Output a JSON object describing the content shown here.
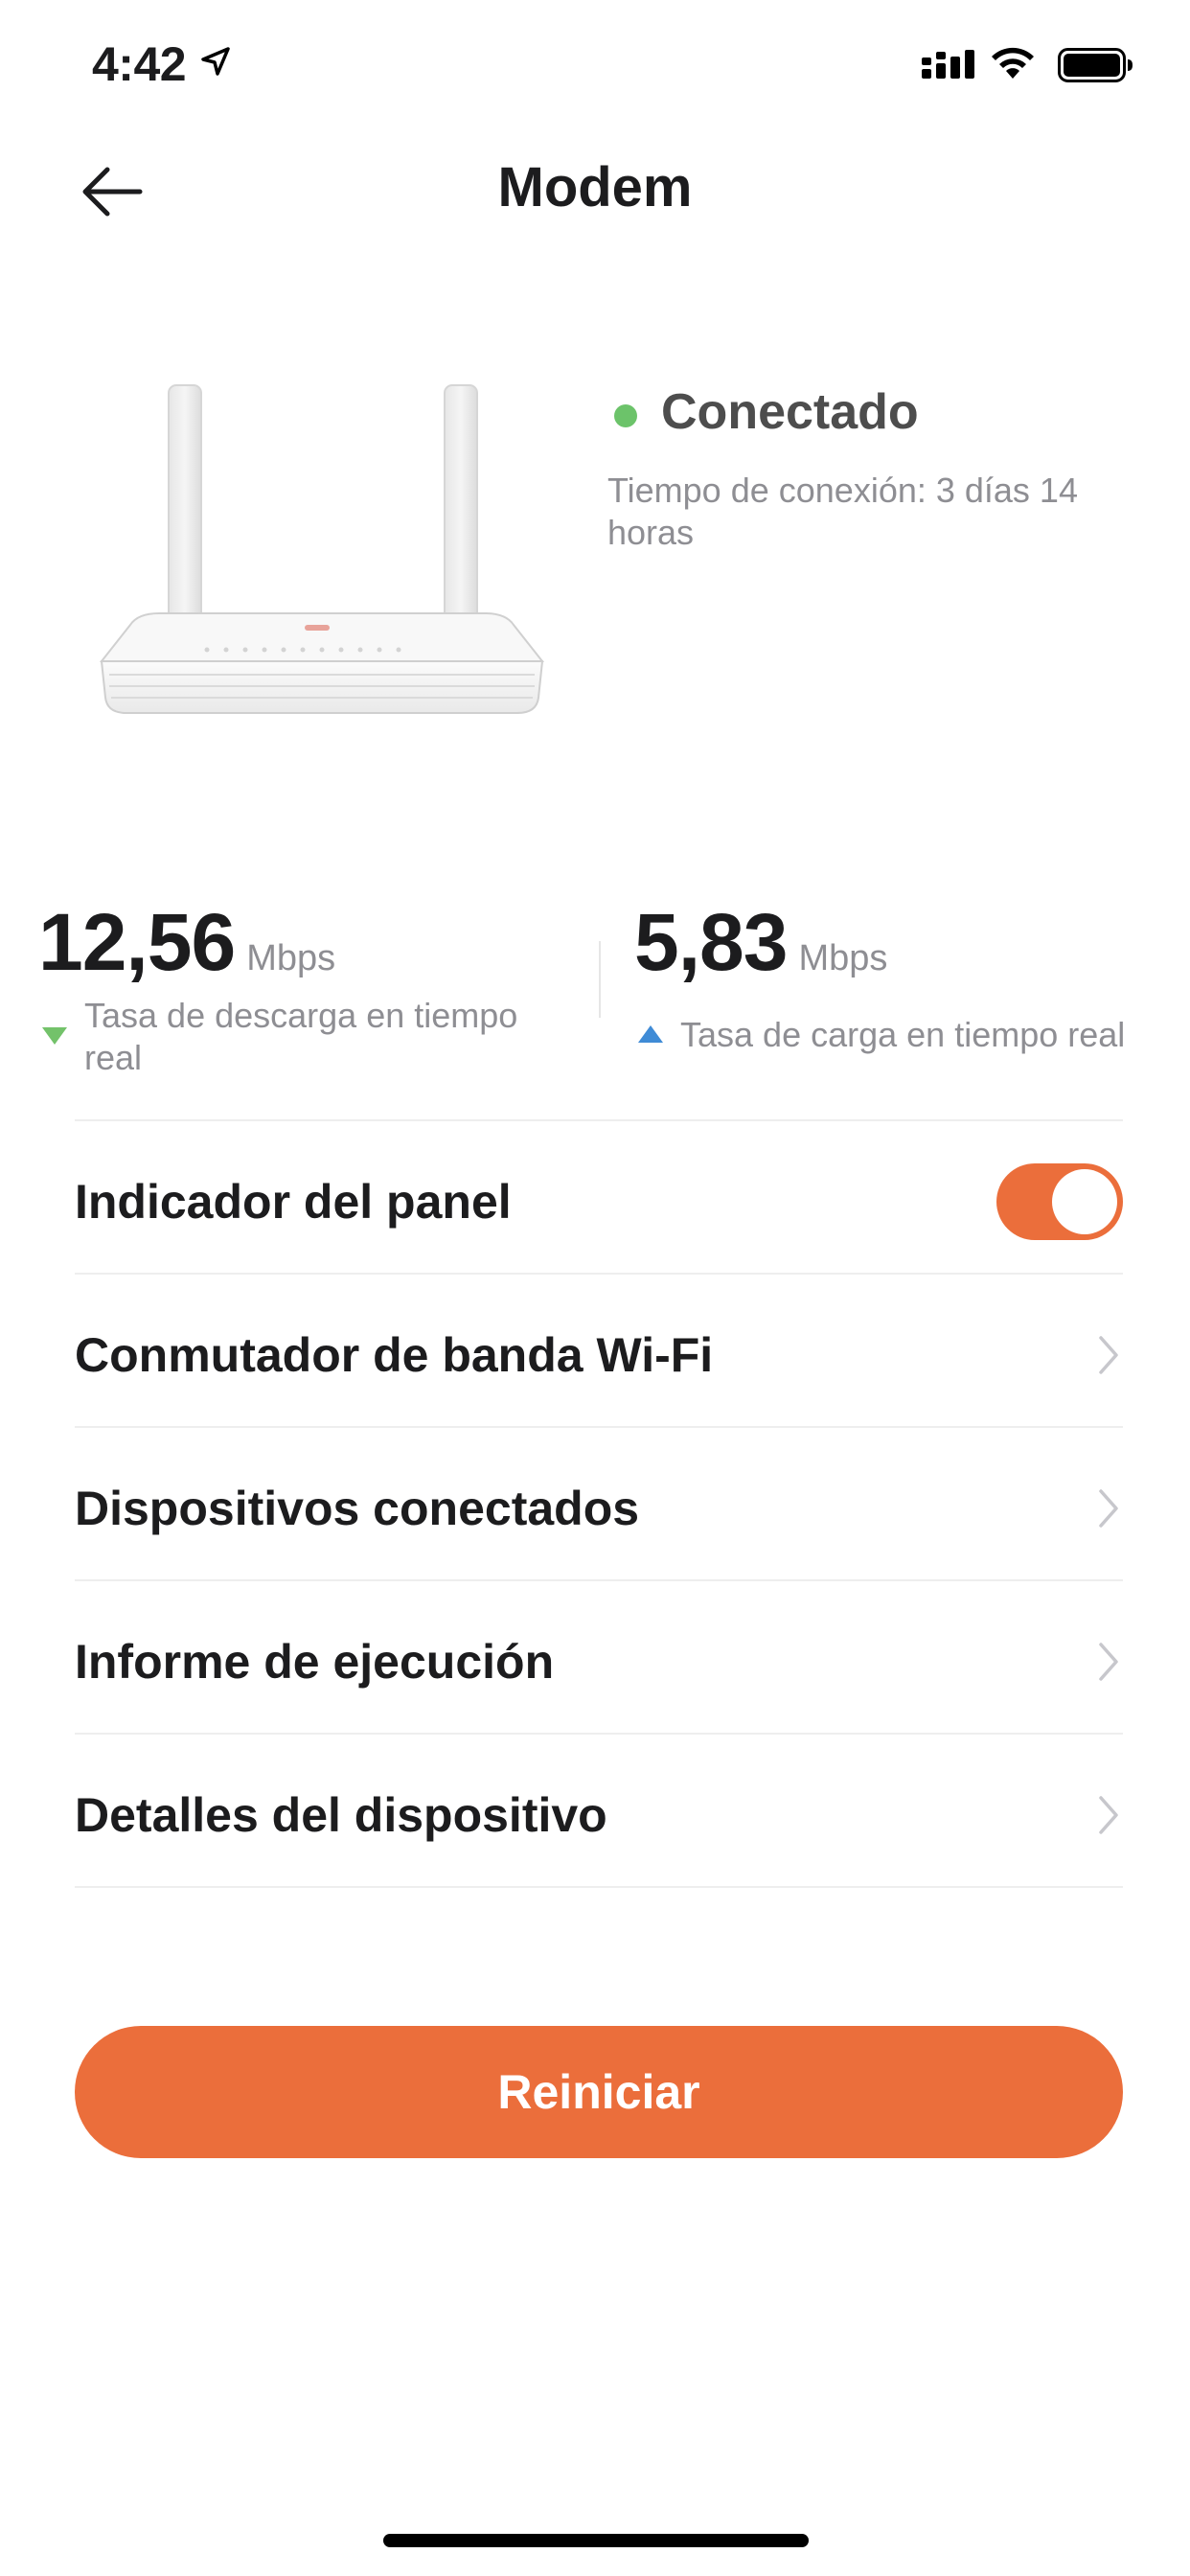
{
  "status_bar": {
    "time": "4:42",
    "icons": [
      "location-arrow-icon",
      "cellular-signal-icon",
      "wifi-icon",
      "battery-icon"
    ]
  },
  "nav": {
    "back_icon": "arrow-left-icon",
    "title": "Modem"
  },
  "device": {
    "image": "router-image",
    "status": "Conectado",
    "status_color": "#6cc36a",
    "uptime": "Tiempo de conexión: 3 días 14 horas"
  },
  "speeds": {
    "download": {
      "value": "12,56",
      "unit": "Mbps",
      "caption": "Tasa de descarga en tiempo real",
      "icon": "triangle-down-icon",
      "color": "#73c26a"
    },
    "upload": {
      "value": "5,83",
      "unit": "Mbps",
      "caption": "Tasa de carga en tiempo real",
      "icon": "triangle-up-icon",
      "color": "#3f8bd6"
    }
  },
  "settings": {
    "panel_indicator": {
      "label": "Indicador del panel",
      "enabled": true
    },
    "items": [
      {
        "label": "Conmutador de banda Wi-Fi",
        "icon": "chevron-right-icon"
      },
      {
        "label": "Dispositivos conectados",
        "icon": "chevron-right-icon"
      },
      {
        "label": "Informe de ejecución",
        "icon": "chevron-right-icon"
      },
      {
        "label": "Detalles del dispositivo",
        "icon": "chevron-right-icon"
      }
    ]
  },
  "actions": {
    "restart_label": "Reiniciar"
  },
  "colors": {
    "accent": "#eb6e3b",
    "text_primary": "#1c1c1e",
    "text_secondary": "#8e8e93"
  }
}
